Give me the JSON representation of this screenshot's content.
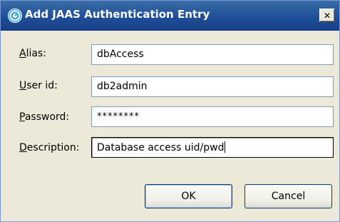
{
  "window": {
    "title": "Add JAAS Authentication Entry",
    "icon": "websphere-swirl-icon",
    "close_glyph": "✕"
  },
  "form": {
    "alias": {
      "label_mnemonic": "A",
      "label_rest": "lias:",
      "value": "dbAccess"
    },
    "user_id": {
      "label_mnemonic": "U",
      "label_rest": "ser id:",
      "value": "db2admin"
    },
    "password": {
      "label_mnemonic": "P",
      "label_rest": "assword:",
      "value": "********"
    },
    "description": {
      "label_mnemonic": "D",
      "label_rest": "escription:",
      "value": "Database access uid/pwd"
    }
  },
  "buttons": {
    "ok_label": "OK",
    "cancel_label": "Cancel"
  },
  "colors": {
    "titlebar": "#1f4f99",
    "dialog_bg": "#ece9d8",
    "field_border": "#7f9db9"
  }
}
